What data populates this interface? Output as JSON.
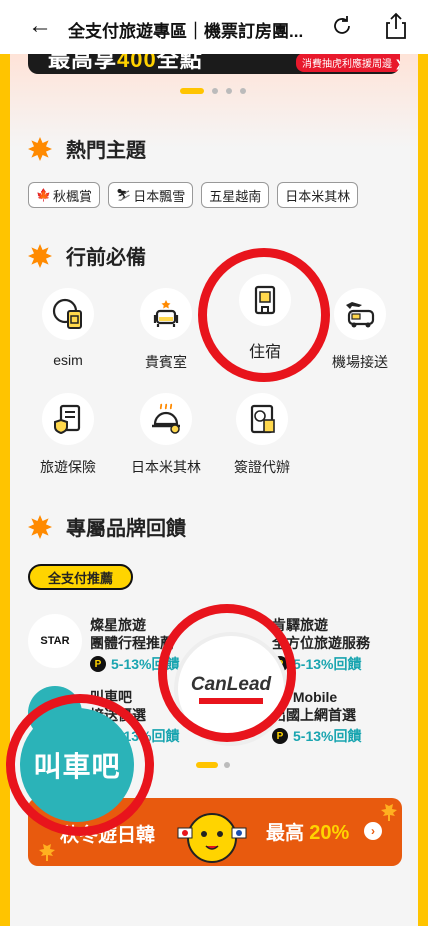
{
  "topbar": {
    "back": "←",
    "title": "全支付旅遊專區｜機票訂房團..."
  },
  "banner": {
    "text": "最高享",
    "highlight": "400",
    "suffix": "全點",
    "pill": "消費抽虎利應援周邊 ❯"
  },
  "hot": {
    "title": "熱門主題",
    "chips": [
      {
        "icon": "🍁",
        "label": "秋楓賞"
      },
      {
        "icon": "⛷",
        "label": "日本飄雪"
      },
      {
        "icon": "",
        "label": "五星越南"
      },
      {
        "icon": "",
        "label": "日本米其林"
      }
    ]
  },
  "prep": {
    "title": "行前必備",
    "items": [
      {
        "label": "esim",
        "icon": "esim-card-icon"
      },
      {
        "label": "貴賓室",
        "icon": "lounge-chair-icon"
      },
      {
        "label": "住宿",
        "icon": "hotel-building-icon"
      },
      {
        "label": "機場接送",
        "icon": "airport-van-icon"
      },
      {
        "label": "旅遊保險",
        "icon": "insurance-shield-icon"
      },
      {
        "label": "日本米其林",
        "icon": "cloche-dish-icon"
      },
      {
        "label": "簽證代辦",
        "icon": "passport-icon"
      }
    ]
  },
  "brands": {
    "title": "專屬品牌回饋",
    "badge": "全支付推薦",
    "items": [
      {
        "name1": "燦星旅遊",
        "name2": "團體行程推薦",
        "rate": "5-13%回饋",
        "logo": "STAR"
      },
      {
        "name1": "肯驛旅遊",
        "name2": "全方位旅遊服務",
        "rate": "5-13%回饋",
        "logo": "CanLead"
      },
      {
        "name1": "叫車吧",
        "name2": "接送優選",
        "rate": "5-13%回饋",
        "logo": "叫車吧"
      },
      {
        "name1": "Wi Mobile",
        "name2": "出國上網首選",
        "rate": "5-13%回饋",
        "logo": "Wi"
      }
    ]
  },
  "promo": {
    "left": "秋冬遊日韓",
    "right": "最高",
    "percent": "20%"
  },
  "colors": {
    "accent": "#ffc400",
    "red": "#e8141c",
    "teal": "#1aa5b0",
    "orange": "#e85a0e"
  }
}
